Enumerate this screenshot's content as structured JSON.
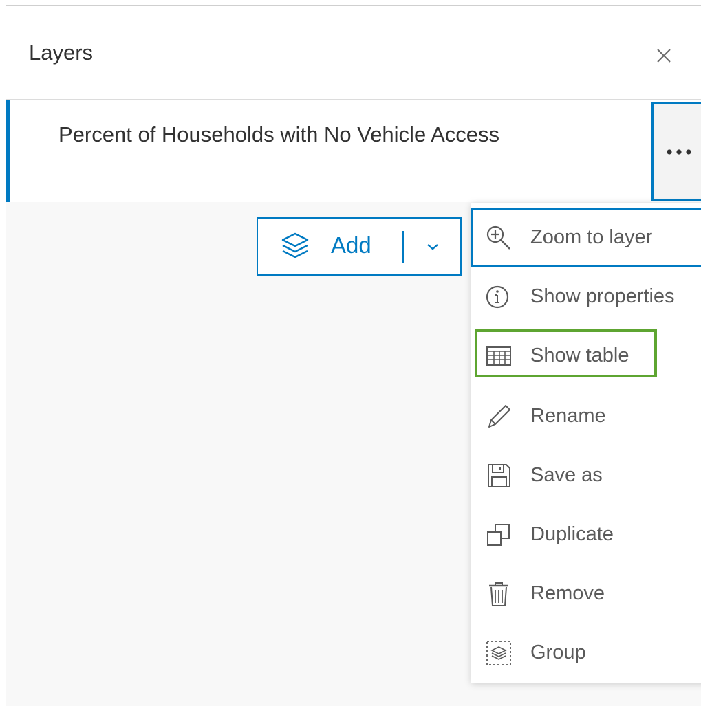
{
  "panel": {
    "title": "Layers",
    "close_icon": "close-icon"
  },
  "layer": {
    "title": "Percent of Households with No Vehicle Access",
    "more_icon": "ellipsis-icon"
  },
  "add_button": {
    "label": "Add",
    "icon": "layers-icon",
    "dropdown_icon": "chevron-down-icon"
  },
  "menu": {
    "items": [
      {
        "label": "Zoom to layer",
        "icon": "zoom-in-icon"
      },
      {
        "label": "Show properties",
        "icon": "info-icon"
      },
      {
        "label": "Show table",
        "icon": "table-icon"
      },
      {
        "label": "Rename",
        "icon": "pencil-icon"
      },
      {
        "label": "Save as",
        "icon": "save-icon"
      },
      {
        "label": "Duplicate",
        "icon": "duplicate-icon"
      },
      {
        "label": "Remove",
        "icon": "trash-icon"
      },
      {
        "label": "Group",
        "icon": "group-layers-icon"
      }
    ]
  },
  "colors": {
    "accent": "#007ac2",
    "highlight": "#5ea531",
    "text": "#323232",
    "muted_text": "#5a5a5a"
  }
}
